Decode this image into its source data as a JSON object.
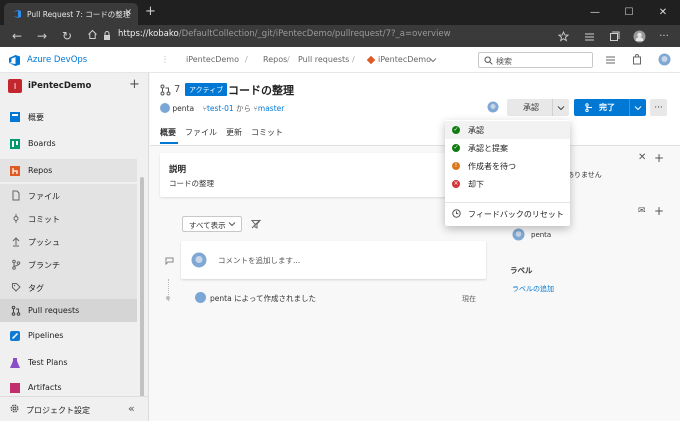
{
  "browser": {
    "tab_title": "Pull Request 7: コードの整理",
    "url_host": "https://kobako",
    "url_path": "/DefaultCollection/_git/iPentecDemo/pullrequest/7?_a=overview"
  },
  "header": {
    "brand": "Azure DevOps",
    "breadcrumb": [
      "iPentecDemo",
      "Repos",
      "Pull requests",
      "iPentecDemo"
    ],
    "search_placeholder": "検索"
  },
  "sidebar": {
    "project_initial": "I",
    "project_name": "iPentecDemo",
    "items": [
      {
        "label": "概要",
        "icon": "overview-icon"
      },
      {
        "label": "Boards",
        "icon": "boards-icon"
      },
      {
        "label": "Repos",
        "icon": "repos-icon"
      },
      {
        "label": "ファイル",
        "icon": "file-icon"
      },
      {
        "label": "コミット",
        "icon": "commit-icon"
      },
      {
        "label": "プッシュ",
        "icon": "push-icon"
      },
      {
        "label": "ブランチ",
        "icon": "branch-icon"
      },
      {
        "label": "タグ",
        "icon": "tag-icon"
      },
      {
        "label": "Pull requests",
        "icon": "pull-request-icon"
      },
      {
        "label": "Pipelines",
        "icon": "pipelines-icon"
      },
      {
        "label": "Test Plans",
        "icon": "test-plans-icon"
      },
      {
        "label": "Artifacts",
        "icon": "artifacts-icon"
      }
    ],
    "settings_label": "プロジェクト設定"
  },
  "pr": {
    "id": "7",
    "status": "アクティブ",
    "title": "コードの整理",
    "author": "penta",
    "source_branch": "test-01",
    "from_label": "から",
    "target_branch": "master",
    "tabs": [
      "概要",
      "ファイル",
      "更新",
      "コミット"
    ],
    "approve_label": "承認",
    "complete_label": "完了"
  },
  "description": {
    "title": "説明",
    "body": "コードの整理"
  },
  "timeline": {
    "filter_label": "すべて表示",
    "comment_placeholder": "コメントを追加します...",
    "activity_author": "penta",
    "activity_text": "によって作成されました",
    "activity_time": "現在"
  },
  "right_panel": {
    "partial_text": "ありません",
    "reviewer_name": "penta",
    "labels_heading": "ラベル",
    "add_label_link": "ラベルの追加"
  },
  "dropdown": {
    "items": [
      {
        "label": "承認",
        "color": "#107c10",
        "glyph": "✓"
      },
      {
        "label": "承認と提案",
        "color": "#107c10",
        "glyph": "✓"
      },
      {
        "label": "作成者を待つ",
        "color": "#d87a1c",
        "glyph": "!"
      },
      {
        "label": "却下",
        "color": "#d13438",
        "glyph": "×"
      }
    ],
    "reset_label": "フィードバックのリセット"
  }
}
